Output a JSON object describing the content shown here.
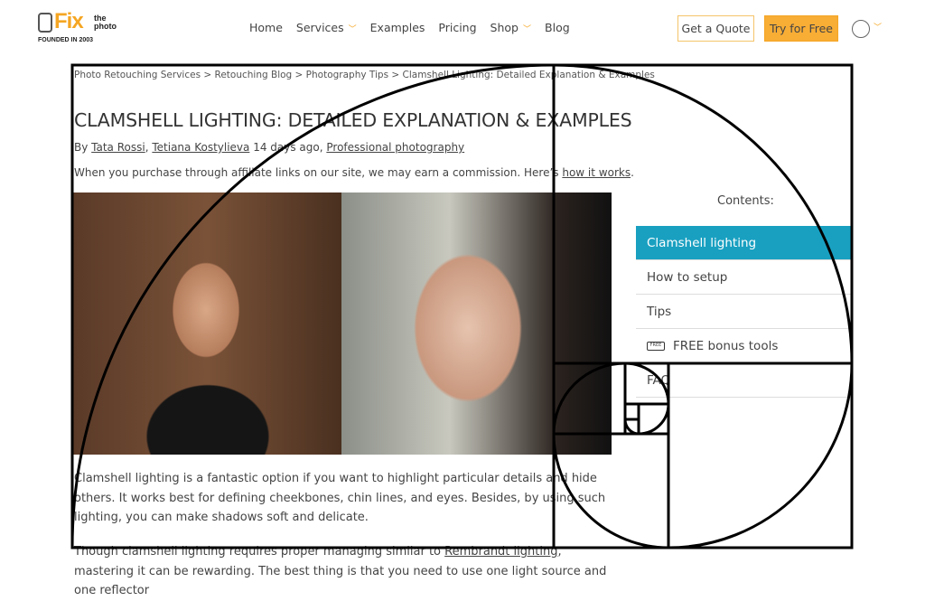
{
  "logo": {
    "brand": "Fix",
    "sub": "the photo",
    "tagline": "FOUNDED IN 2003"
  },
  "nav": {
    "items": [
      "Home",
      "Services",
      "Examples",
      "Pricing",
      "Shop",
      "Blog"
    ]
  },
  "header": {
    "quote": "Get a Quote",
    "try": "Try for Free"
  },
  "breadcrumb": "Photo Retouching Services > Retouching Blog > Photography Tips > Clamshell Lighting: Detailed Explanation & Examples",
  "article": {
    "title": "CLAMSHELL LIGHTING: DETAILED EXPLANATION & EXAMPLES",
    "by": "By ",
    "author1": "Tata Rossi",
    "sep": ", ",
    "author2": "Tetiana Kostylieva",
    "date": " 14 days ago, ",
    "category": "Professional photography",
    "aff_text": "When you purchase through affiliate links on our site, we may earn a commission. Here’s ",
    "aff_link": "how it works",
    "aff_end": ".",
    "p1": "Clamshell lighting is a fantastic option if you want to highlight particular details and hide others. It works best for defining cheekbones, chin lines, and eyes. Besides, by using such lighting, you can make shadows soft and delicate.",
    "p2a": "Though clamshell lighting requires proper managing similar to ",
    "p2link": "Rembrandt lighting",
    "p2b": ", mastering it can be rewarding. The best thing is that you need to use one light source and one reflector"
  },
  "toc": {
    "title": "Contents:",
    "items": [
      "Clamshell lighting",
      "How to setup",
      "Tips",
      "FREE bonus tools",
      "FAQ"
    ],
    "free_badge": "FREE"
  },
  "colors": {
    "accent": "#f8ad35",
    "toc_active": "#19a0c1"
  }
}
